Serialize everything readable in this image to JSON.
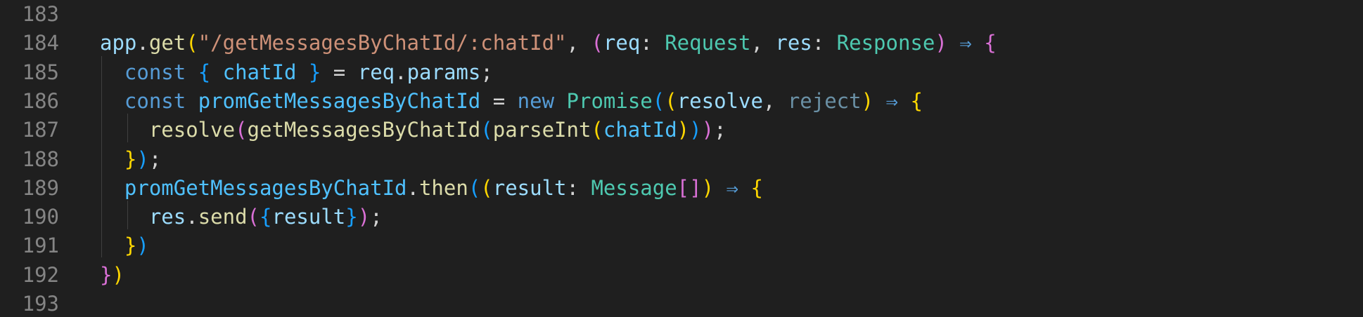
{
  "editor": {
    "language": "typescript",
    "colors": {
      "background": "#1f1f1f",
      "line_number": "#858585",
      "variable": "#9cdcfe",
      "function": "#dcdcaa",
      "string": "#ce9178",
      "type": "#4ec9b0",
      "keyword": "#569cd6",
      "bracket_gold": "#ffd700",
      "bracket_orchid": "#da70d6",
      "bracket_blue": "#179fff"
    },
    "lines": [
      {
        "number": "183",
        "tokens": []
      },
      {
        "number": "184",
        "tokens": [
          {
            "text": "app",
            "kind": "var"
          },
          {
            "text": ".",
            "kind": "plain"
          },
          {
            "text": "get",
            "kind": "fn"
          },
          {
            "text": "(",
            "kind": "b1"
          },
          {
            "text": "\"/getMessagesByChatId/:chatId\"",
            "kind": "str"
          },
          {
            "text": ", ",
            "kind": "plain"
          },
          {
            "text": "(",
            "kind": "b2"
          },
          {
            "text": "req",
            "kind": "var"
          },
          {
            "text": ": ",
            "kind": "plain"
          },
          {
            "text": "Request",
            "kind": "type"
          },
          {
            "text": ", ",
            "kind": "plain"
          },
          {
            "text": "res",
            "kind": "var"
          },
          {
            "text": ": ",
            "kind": "plain"
          },
          {
            "text": "Response",
            "kind": "type"
          },
          {
            "text": ")",
            "kind": "b2"
          },
          {
            "text": " ⇒ ",
            "kind": "op"
          },
          {
            "text": "{",
            "kind": "b2"
          }
        ]
      },
      {
        "number": "185",
        "tokens": [
          {
            "text": "  ",
            "kind": "plain"
          },
          {
            "text": "const",
            "kind": "kw"
          },
          {
            "text": " ",
            "kind": "plain"
          },
          {
            "text": "{",
            "kind": "b3"
          },
          {
            "text": " ",
            "kind": "plain"
          },
          {
            "text": "chatId",
            "kind": "const"
          },
          {
            "text": " ",
            "kind": "plain"
          },
          {
            "text": "}",
            "kind": "b3"
          },
          {
            "text": " = ",
            "kind": "plain"
          },
          {
            "text": "req",
            "kind": "var"
          },
          {
            "text": ".",
            "kind": "plain"
          },
          {
            "text": "params",
            "kind": "var"
          },
          {
            "text": ";",
            "kind": "plain"
          }
        ]
      },
      {
        "number": "186",
        "tokens": [
          {
            "text": "  ",
            "kind": "plain"
          },
          {
            "text": "const",
            "kind": "kw"
          },
          {
            "text": " ",
            "kind": "plain"
          },
          {
            "text": "promGetMessagesByChatId",
            "kind": "const"
          },
          {
            "text": " = ",
            "kind": "plain"
          },
          {
            "text": "new",
            "kind": "kw"
          },
          {
            "text": " ",
            "kind": "plain"
          },
          {
            "text": "Promise",
            "kind": "type"
          },
          {
            "text": "(",
            "kind": "b3"
          },
          {
            "text": "(",
            "kind": "b1"
          },
          {
            "text": "resolve",
            "kind": "var"
          },
          {
            "text": ", ",
            "kind": "plain"
          },
          {
            "text": "reject",
            "kind": "unused"
          },
          {
            "text": ")",
            "kind": "b1"
          },
          {
            "text": " ⇒ ",
            "kind": "op"
          },
          {
            "text": "{",
            "kind": "b1"
          }
        ]
      },
      {
        "number": "187",
        "tokens": [
          {
            "text": "    ",
            "kind": "plain"
          },
          {
            "text": "resolve",
            "kind": "fn"
          },
          {
            "text": "(",
            "kind": "b2"
          },
          {
            "text": "getMessagesByChatId",
            "kind": "fn"
          },
          {
            "text": "(",
            "kind": "b3"
          },
          {
            "text": "parseInt",
            "kind": "fn"
          },
          {
            "text": "(",
            "kind": "b1"
          },
          {
            "text": "chatId",
            "kind": "const"
          },
          {
            "text": ")",
            "kind": "b1"
          },
          {
            "text": ")",
            "kind": "b3"
          },
          {
            "text": ")",
            "kind": "b2"
          },
          {
            "text": ";",
            "kind": "plain"
          }
        ]
      },
      {
        "number": "188",
        "tokens": [
          {
            "text": "  ",
            "kind": "plain"
          },
          {
            "text": "}",
            "kind": "b1"
          },
          {
            "text": ")",
            "kind": "b3"
          },
          {
            "text": ";",
            "kind": "plain"
          }
        ]
      },
      {
        "number": "189",
        "tokens": [
          {
            "text": "  ",
            "kind": "plain"
          },
          {
            "text": "promGetMessagesByChatId",
            "kind": "const"
          },
          {
            "text": ".",
            "kind": "plain"
          },
          {
            "text": "then",
            "kind": "fn"
          },
          {
            "text": "(",
            "kind": "b3"
          },
          {
            "text": "(",
            "kind": "b1"
          },
          {
            "text": "result",
            "kind": "var"
          },
          {
            "text": ": ",
            "kind": "plain"
          },
          {
            "text": "Message",
            "kind": "type"
          },
          {
            "text": "[]",
            "kind": "b2"
          },
          {
            "text": ")",
            "kind": "b1"
          },
          {
            "text": " ⇒ ",
            "kind": "op"
          },
          {
            "text": "{",
            "kind": "b1"
          }
        ]
      },
      {
        "number": "190",
        "tokens": [
          {
            "text": "    ",
            "kind": "plain"
          },
          {
            "text": "res",
            "kind": "var"
          },
          {
            "text": ".",
            "kind": "plain"
          },
          {
            "text": "send",
            "kind": "fn"
          },
          {
            "text": "(",
            "kind": "b2"
          },
          {
            "text": "{",
            "kind": "b3"
          },
          {
            "text": "result",
            "kind": "var"
          },
          {
            "text": "}",
            "kind": "b3"
          },
          {
            "text": ")",
            "kind": "b2"
          },
          {
            "text": ";",
            "kind": "plain"
          }
        ]
      },
      {
        "number": "191",
        "tokens": [
          {
            "text": "  ",
            "kind": "plain"
          },
          {
            "text": "}",
            "kind": "b1"
          },
          {
            "text": ")",
            "kind": "b3"
          }
        ]
      },
      {
        "number": "192",
        "tokens": [
          {
            "text": "}",
            "kind": "b2"
          },
          {
            "text": ")",
            "kind": "b1"
          }
        ]
      },
      {
        "number": "193",
        "tokens": []
      }
    ]
  }
}
